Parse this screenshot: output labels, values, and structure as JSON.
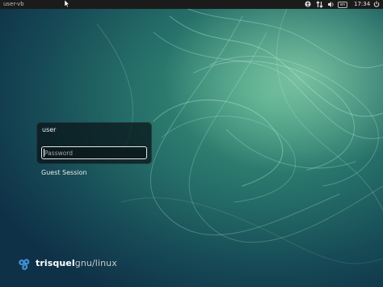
{
  "topbar": {
    "hostname": "user-vb",
    "clock": "17:34",
    "indicators": [
      "accessibility-icon",
      "network-icon",
      "volume-icon",
      "keyboard-layout-icon",
      "power-icon"
    ],
    "keyboard_badge": "en",
    "colors": {
      "bar": "#1b1b1b",
      "text": "#d2d2d2"
    }
  },
  "login": {
    "user": "user",
    "password_placeholder": "Password",
    "guest_session": "Guest Session"
  },
  "branding": {
    "logo_part1": "trisquel",
    "logo_part2": "gnu/linux"
  },
  "colors": {
    "background_dark": "#0f3147",
    "background_mid": "#256e68",
    "background_light": "#afebc3",
    "panel": "#081216"
  }
}
